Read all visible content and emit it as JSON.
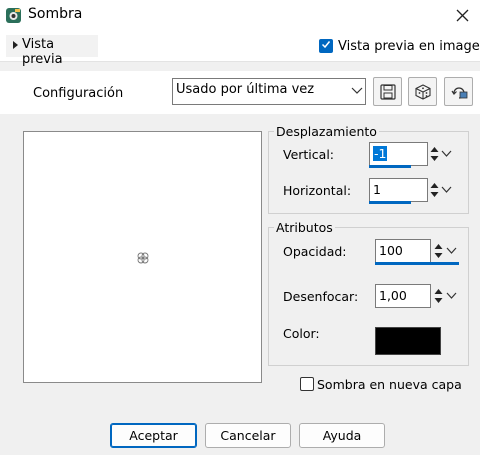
{
  "window": {
    "title": "Sombra",
    "close_icon": "close-icon"
  },
  "toolbar": {
    "preview_toggle_label": "Vista previa",
    "preview_in_image_label": "Vista previa en imagen",
    "preview_in_image_checked": true
  },
  "config": {
    "label": "Configuración",
    "preset_value": "Usado por última vez",
    "icons": [
      "save-icon",
      "random-dice-icon",
      "reset-defaults-icon"
    ]
  },
  "displacement": {
    "legend": "Desplazamiento",
    "vertical_label": "Vertical:",
    "vertical_value": "-1",
    "horizontal_label": "Horizontal:",
    "horizontal_value": "1"
  },
  "attributes": {
    "legend": "Atributos",
    "opacity_label": "Opacidad:",
    "opacity_value": "100",
    "blur_label": "Desenfocar:",
    "blur_value": "1,00",
    "color_label": "Color:",
    "color_hex": "#000000"
  },
  "new_layer": {
    "label": "Sombra en nueva capa",
    "checked": false
  },
  "buttons": {
    "ok": "Aceptar",
    "cancel": "Cancelar",
    "help": "Ayuda"
  },
  "colors": {
    "accent": "#0067c0"
  }
}
